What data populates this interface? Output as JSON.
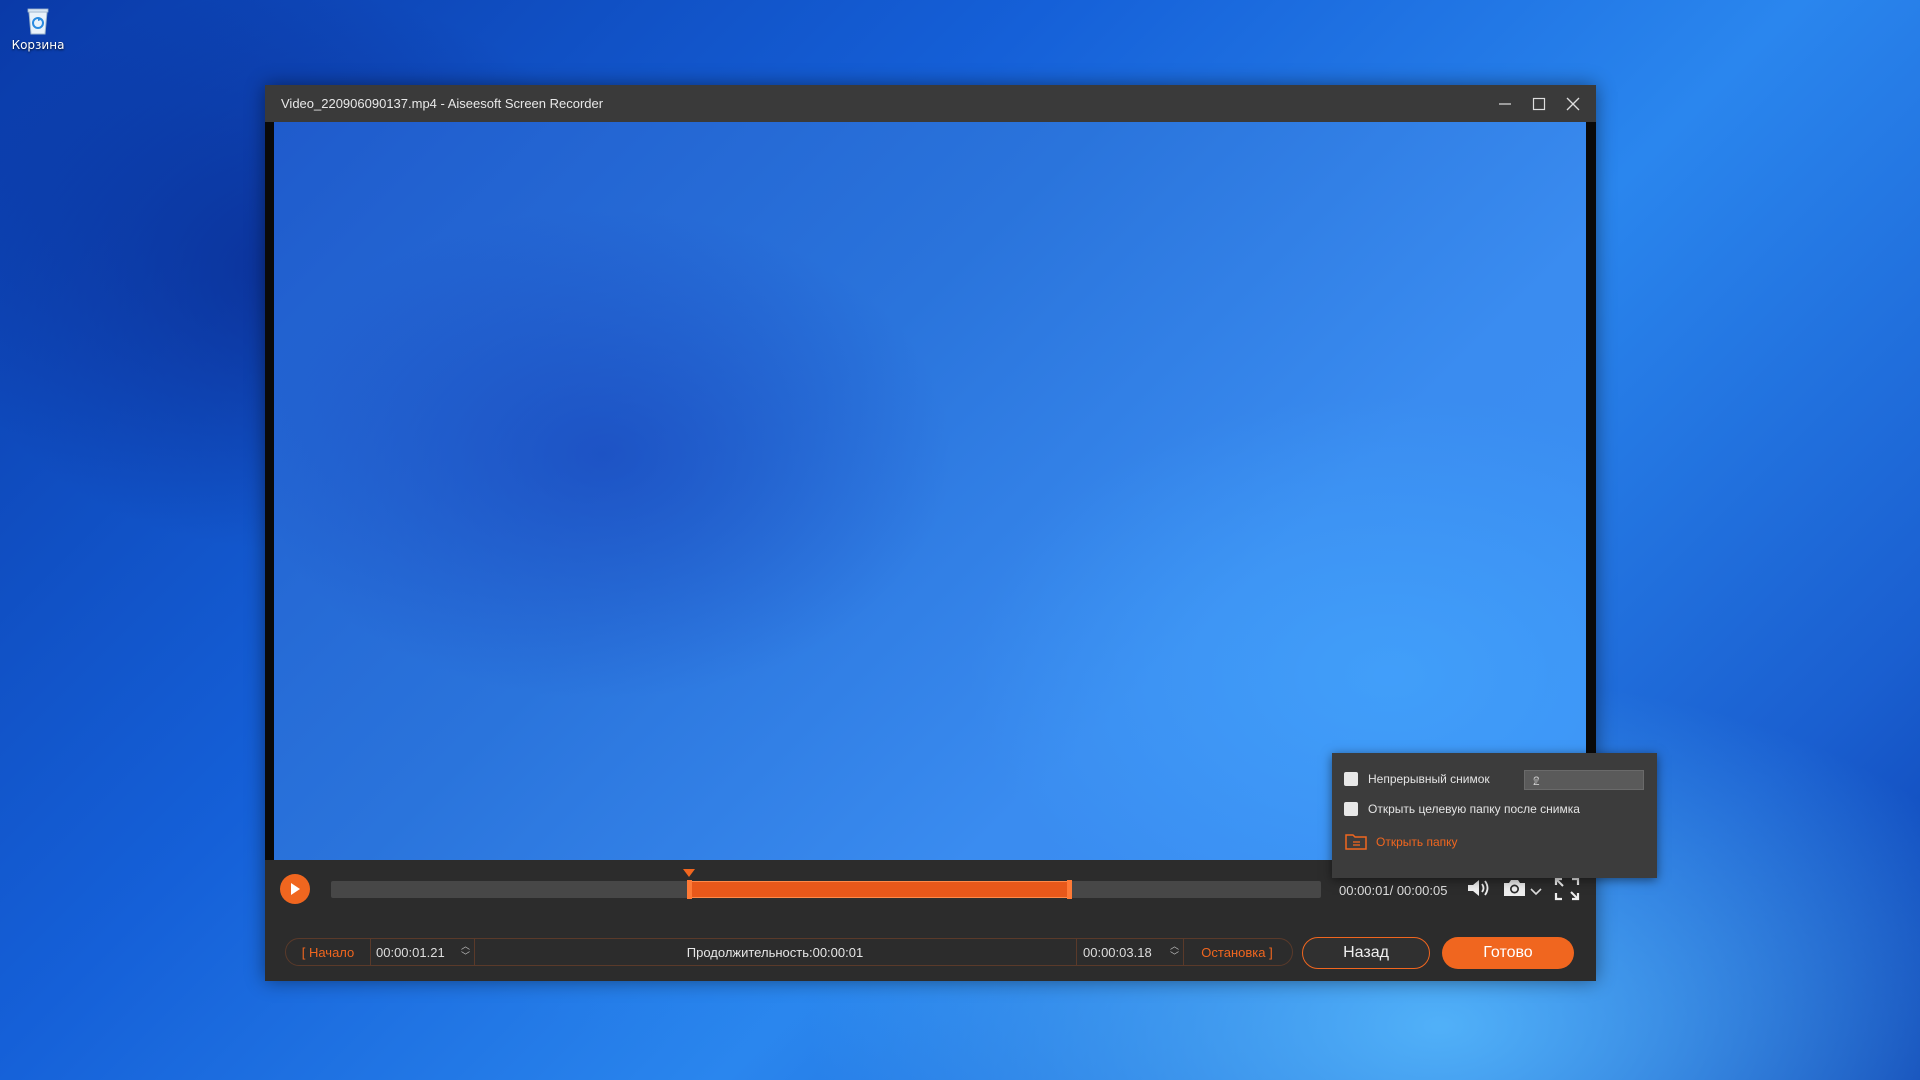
{
  "desktop": {
    "recycle_bin_label": "Корзина"
  },
  "window": {
    "title": "Video_220906090137.mp4  -  Aiseesoft Screen Recorder"
  },
  "player": {
    "time_display": "00:00:01/ 00:00:05",
    "progress": {
      "selection_start_fraction": 0.362,
      "selection_end_fraction": 0.746
    }
  },
  "trim": {
    "start_label": "[ Начало",
    "start_time": "00:00:01.21",
    "duration": "Продолжительность:00:00:01",
    "end_time": "00:00:03.18",
    "stop_label": "Остановка ]"
  },
  "actions": {
    "back_label": "Назад",
    "done_label": "Готово"
  },
  "snapshot_menu": {
    "continuous_label": "Непрерывный снимок",
    "continuous_count": "2",
    "open_after_label": "Открыть целевую папку после снимка",
    "open_folder_label": "Открыть папку"
  },
  "colors": {
    "accent": "#f0661f",
    "titlebar": "#3a3a3a",
    "panel": "#2c2c2c"
  }
}
